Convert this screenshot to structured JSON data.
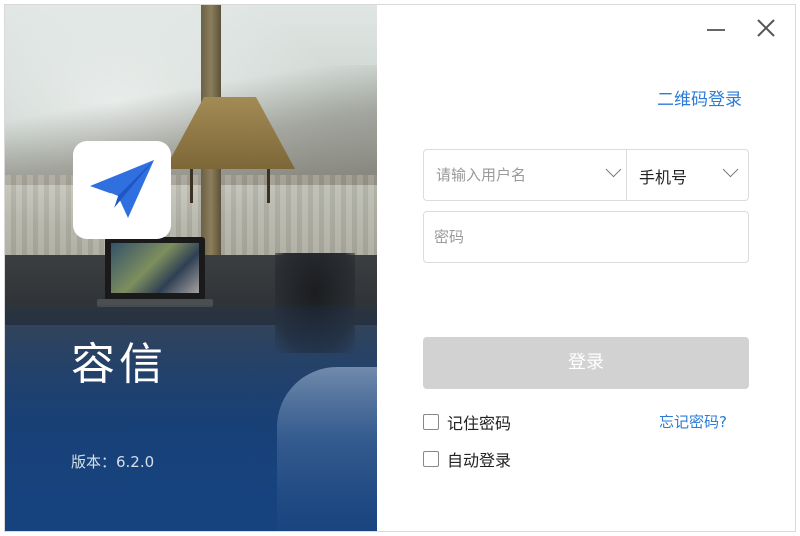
{
  "window": {
    "minimize_icon": "minimize-icon",
    "close_icon": "close-icon"
  },
  "brand": {
    "app_name": "容信",
    "version": "版本：6.2.0",
    "logo_icon": "paper-plane-icon",
    "accent": "#2f6fe0"
  },
  "login": {
    "qr_login_label": "二维码登录",
    "username_placeholder": "请输入用户名",
    "account_type": "手机号",
    "password_placeholder": "密码",
    "submit_label": "登录",
    "remember_label": "记住密码",
    "forgot_label": "忘记密码?",
    "auto_login_label": "自动登录"
  },
  "colors": {
    "link": "#2b7bd8",
    "button_disabled": "#d2d2d2",
    "hero_overlay": "#16427e"
  }
}
